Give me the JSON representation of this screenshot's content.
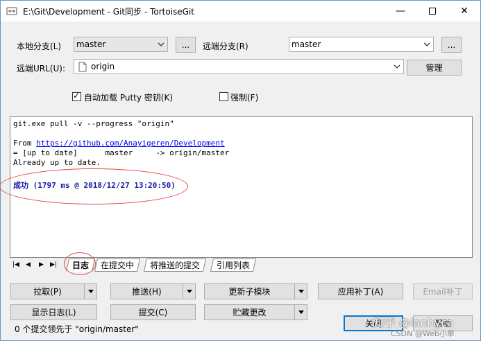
{
  "window": {
    "title": "E:\\Git\\Development - Git同步 - TortoiseGit",
    "min_glyph": "—",
    "close_glyph": "✕"
  },
  "form": {
    "local_branch_label": "本地分支(L)",
    "local_branch_value": "master",
    "browse_local": "...",
    "remote_branch_label": "远端分支(R)",
    "remote_branch_value": "master",
    "browse_remote": "...",
    "remote_url_label": "远端URL(U):",
    "remote_url_value": "origin",
    "manage_button": "管理",
    "autoload_putty_label": "自动加载 Putty 密钥(K)",
    "autoload_putty_checked": true,
    "force_label": "强制(F)",
    "force_checked": false,
    "check_glyph": "✓"
  },
  "log": {
    "lines": [
      "git.exe pull -v --progress \"origin\"",
      "",
      "From ",
      "= [up to date]      master     -> origin/master",
      "Already up to date.",
      "",
      ""
    ],
    "from_url": "https://github.com/Anayigeren/Development",
    "success_line": "成功 (1797 ms @ 2018/12/27 13:20:50)"
  },
  "tabs": {
    "nav_first": "|◀",
    "nav_prev": "◀",
    "nav_next": "▶",
    "nav_last": "▶|",
    "items": [
      "日志",
      "在提交中",
      "将推送的提交",
      "引用列表"
    ]
  },
  "buttons": {
    "pull": "拉取(P)",
    "push": "推送(H)",
    "update_submodules": "更新子模块",
    "apply_patch": "应用补丁(A)",
    "email_patch": "Email补丁",
    "show_log": "显示日志(L)",
    "commit": "提交(C)",
    "stash": "贮藏更改",
    "close": "关闭",
    "help": "帮助"
  },
  "status": {
    "text": "0 个提交领先于 \"origin/master\""
  },
  "watermark": {
    "main": "知乎 @lanhyca",
    "sub": "CSDN @Web小单"
  },
  "colors": {
    "accent": "#0078d7",
    "annotation": "#e14848",
    "success_text": "#1a1aa6"
  }
}
